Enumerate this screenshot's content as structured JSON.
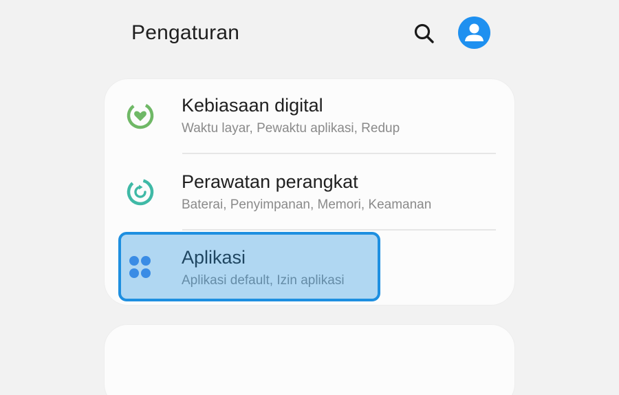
{
  "header": {
    "title": "Pengaturan",
    "search_icon": "search-icon",
    "avatar_icon": "account-avatar-icon",
    "avatar_color": "#1e90f0"
  },
  "settings": {
    "items": [
      {
        "label": "Kebiasaan digital",
        "sub": "Waktu layar, Pewaktu aplikasi, Redup",
        "icon": "digital-wellbeing-icon",
        "icon_color": "#6fb866"
      },
      {
        "label": "Perawatan perangkat",
        "sub": "Baterai, Penyimpanan, Memori, Keamanan",
        "icon": "device-care-icon",
        "icon_color": "#3fb9a6"
      },
      {
        "label": "Aplikasi",
        "sub": "Aplikasi default, Izin aplikasi",
        "icon": "apps-icon",
        "icon_color": "#4a8ae8"
      }
    ]
  },
  "highlight_color": "#1e8fe0"
}
